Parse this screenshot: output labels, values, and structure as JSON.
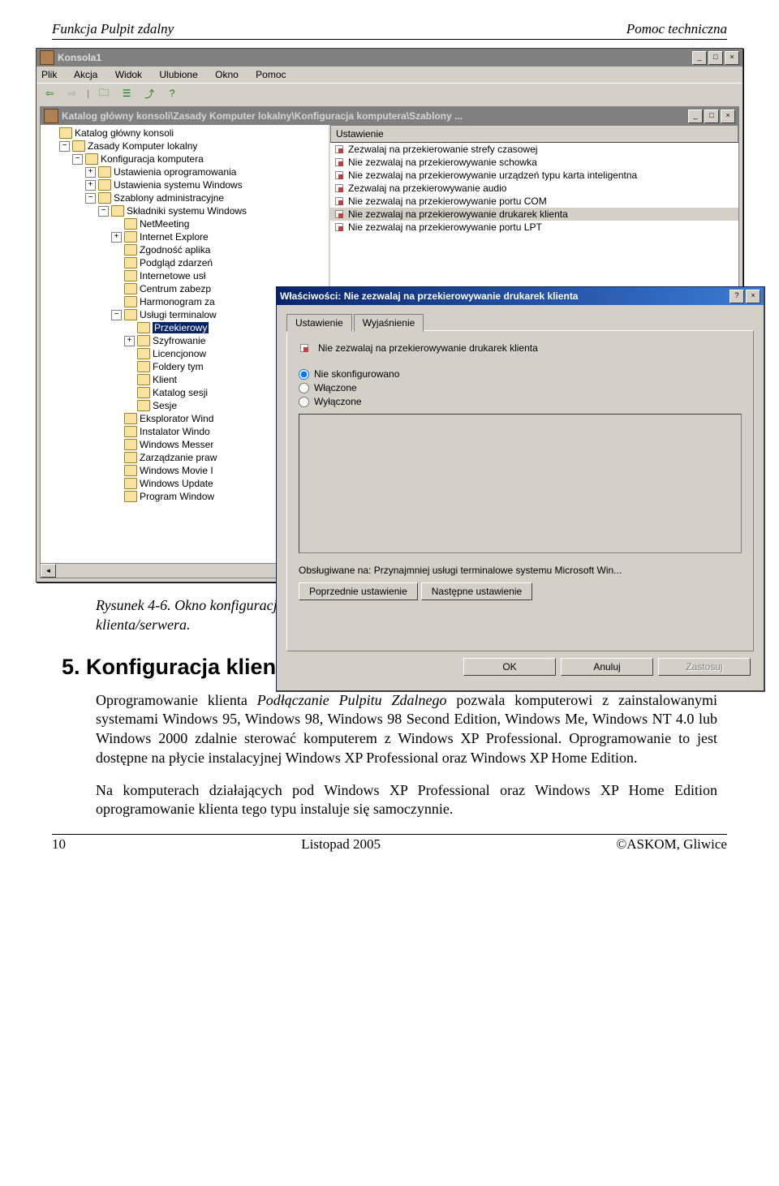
{
  "header": {
    "left": "Funkcja Pulpit zdalny",
    "right": "Pomoc techniczna"
  },
  "footer": {
    "left": "10",
    "center": "Listopad 2005",
    "right": "©ASKOM, Gliwice"
  },
  "caption": "Rysunek 4-6. Okno konfiguracji komputera – usługi terminalowe – Przekierowywanie danych klienta/serwera.",
  "section_title": "5. Konfiguracja klienta",
  "para1_pre": "Oprogramowanie klienta ",
  "para1_em": "Podłączanie Pulpitu Zdalnego",
  "para1_post": " pozwala komputerowi z zainstalowanymi systemami Windows 95, Windows 98, Windows 98 Second Edition, Windows Me, Windows NT 4.0 lub Windows 2000 zdalnie sterować komputerem z Windows XP Professional. Oprogramowanie to jest dostępne na płycie instalacyjnej Windows XP Professional oraz Windows XP Home Edition.",
  "para2": "Na komputerach działających pod Windows XP Professional oraz Windows XP Home Edition oprogramowanie klienta tego typu instaluje się samoczynnie.",
  "mmc": {
    "title": "Konsola1",
    "menus": [
      "Plik",
      "Akcja",
      "Widok",
      "Ulubione",
      "Okno",
      "Pomoc"
    ],
    "child_title": "Katalog główny konsoli\\Zasady Komputer lokalny\\Konfiguracja komputera\\Szablony ...",
    "list_header": "Ustawienie",
    "list": [
      "Zezwalaj na przekierowanie strefy czasowej",
      "Nie zezwalaj na przekierowywanie schowka",
      "Nie zezwalaj na przekierowywanie urządzeń typu karta inteligentna",
      "Zezwalaj na przekierowywanie audio",
      "Nie zezwalaj na przekierowywanie portu COM",
      "Nie zezwalaj na przekierowywanie drukarek klienta",
      "Nie zezwalaj na przekierowywanie portu LPT"
    ],
    "list_selected_index": 5,
    "tree": [
      {
        "d": 0,
        "e": "",
        "t": "Katalog główny konsoli"
      },
      {
        "d": 1,
        "e": "−",
        "t": "Zasady Komputer lokalny",
        "icon": "policy"
      },
      {
        "d": 2,
        "e": "−",
        "t": "Konfiguracja komputera",
        "icon": "comp"
      },
      {
        "d": 3,
        "e": "+",
        "t": "Ustawienia oprogramowania"
      },
      {
        "d": 3,
        "e": "+",
        "t": "Ustawienia systemu Windows"
      },
      {
        "d": 3,
        "e": "−",
        "t": "Szablony administracyjne"
      },
      {
        "d": 4,
        "e": "−",
        "t": "Składniki systemu Windows"
      },
      {
        "d": 5,
        "e": "",
        "t": "NetMeeting"
      },
      {
        "d": 5,
        "e": "+",
        "t": "Internet Explore"
      },
      {
        "d": 5,
        "e": "",
        "t": "Zgodność aplika"
      },
      {
        "d": 5,
        "e": "",
        "t": "Podgląd zdarzeń"
      },
      {
        "d": 5,
        "e": "",
        "t": "Internetowe usł"
      },
      {
        "d": 5,
        "e": "",
        "t": "Centrum zabezp"
      },
      {
        "d": 5,
        "e": "",
        "t": "Harmonogram za"
      },
      {
        "d": 5,
        "e": "−",
        "t": "Usługi terminalow"
      },
      {
        "d": 6,
        "e": "",
        "t": "Przekierowy",
        "sel": true
      },
      {
        "d": 6,
        "e": "+",
        "t": "Szyfrowanie"
      },
      {
        "d": 6,
        "e": "",
        "t": "Licencjonow"
      },
      {
        "d": 6,
        "e": "",
        "t": "Foldery tym"
      },
      {
        "d": 6,
        "e": "",
        "t": "Klient"
      },
      {
        "d": 6,
        "e": "",
        "t": "Katalog sesji"
      },
      {
        "d": 6,
        "e": "",
        "t": "Sesje"
      },
      {
        "d": 5,
        "e": "",
        "t": "Eksplorator Wind"
      },
      {
        "d": 5,
        "e": "",
        "t": "Instalator Windo"
      },
      {
        "d": 5,
        "e": "",
        "t": "Windows Messer"
      },
      {
        "d": 5,
        "e": "",
        "t": "Zarządzanie praw"
      },
      {
        "d": 5,
        "e": "",
        "t": "Windows Movie I"
      },
      {
        "d": 5,
        "e": "",
        "t": "Windows Update"
      },
      {
        "d": 5,
        "e": "",
        "t": "Program Window"
      }
    ]
  },
  "dlg": {
    "title": "Właściwości: Nie zezwalaj na przekierowywanie drukarek klienta",
    "tabs": [
      "Ustawienie",
      "Wyjaśnienie"
    ],
    "heading": "Nie zezwalaj na przekierowywanie drukarek klienta",
    "radios": [
      "Nie skonfigurowano",
      "Włączone",
      "Wyłączone"
    ],
    "radio_selected": 0,
    "supported_label": "Obsługiwane na:",
    "supported_value": "Przynajmniej usługi terminalowe systemu Microsoft Win...",
    "prev": "Poprzednie ustawienie",
    "next": "Następne ustawienie",
    "ok": "OK",
    "cancel": "Anuluj",
    "apply": "Zastosuj"
  }
}
